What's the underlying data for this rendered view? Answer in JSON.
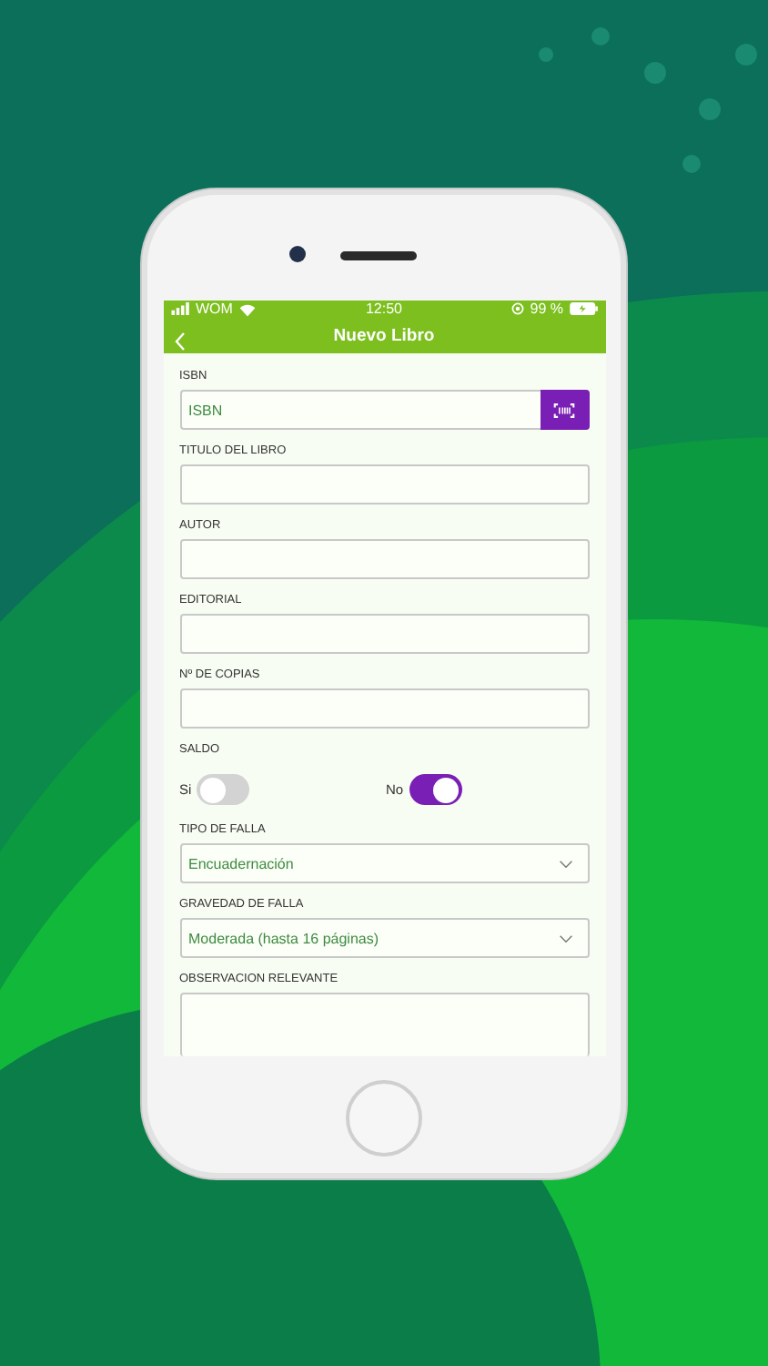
{
  "status_bar": {
    "carrier": "WOM",
    "time": "12:50",
    "battery": "99 %"
  },
  "header": {
    "title": "Nuevo Libro"
  },
  "fields": [
    {
      "kind": "scan",
      "label": "ISBN",
      "placeholder": "ISBN"
    },
    {
      "kind": "text",
      "label": "TITULO DEL LIBRO"
    },
    {
      "kind": "text",
      "label": "AUTOR"
    },
    {
      "kind": "text",
      "label": "EDITORIAL"
    },
    {
      "kind": "text",
      "label": "Nº DE COPIAS"
    },
    {
      "kind": "toggles",
      "label": "SALDO",
      "options": [
        {
          "label": "Si",
          "on": false
        },
        {
          "label": "No",
          "on": true
        }
      ]
    },
    {
      "kind": "select",
      "label": "TIPO DE FALLA",
      "value": "Encuadernación"
    },
    {
      "kind": "select",
      "label": "GRAVEDAD DE FALLA",
      "value": "Moderada (hasta 16 páginas)"
    },
    {
      "kind": "textarea",
      "label": "OBSERVACION RELEVANTE"
    }
  ]
}
